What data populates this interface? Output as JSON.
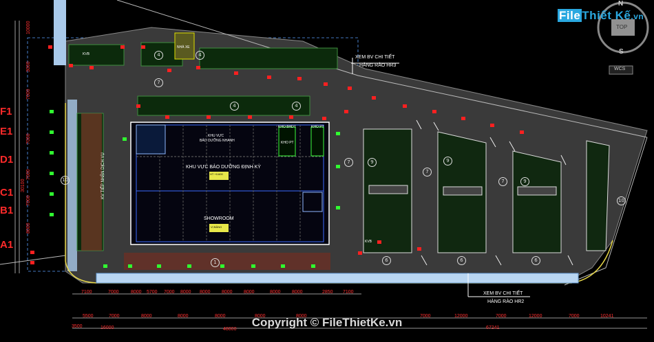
{
  "watermark": {
    "brand": "File",
    "brand2": "Thiết Kế",
    "domain": ".vn",
    "copyright": "Copyright © FileThietKe.vn"
  },
  "compass": {
    "north": "N",
    "south": "S",
    "center": "TOP",
    "wcs": "WCS"
  },
  "axes": [
    "F1",
    "E1",
    "D1",
    "C1",
    "B1",
    "A1"
  ],
  "notes": {
    "hr3_line1": "XEM BV CHI TIẾT",
    "hr3_line2": "HÀNG RÀO HR3",
    "hr2_line1": "XEM BV CHI TIẾT",
    "hr2_line2": "HÀNG RÀO HR2"
  },
  "building": {
    "maintenance_area": "KHU VỰC BẢO DƯỠNG ĐỊNH KỲ",
    "showroom": "SHOWROOM",
    "tag_top": "KHU VỰC",
    "tag_sub": "BẢO DƯỠNG NHANH",
    "room_a": "KHO BHDT",
    "room_b": "KHO PT",
    "room_c": "KHO PT",
    "elev1": "HT +0.600",
    "elev2": "VỊ BẢNG"
  },
  "side_labels": {
    "left_strip": "KV TIẾP NHẬN DỊCH VỤ",
    "gate": "KVB",
    "gate2": "KVB",
    "guard": "NHÀ XE"
  },
  "dims_row1": [
    "7100",
    "7000",
    "8000",
    "5700",
    "7000",
    "8000",
    "8000",
    "8000",
    "8000",
    "8000",
    "8000",
    "2850",
    "7100"
  ],
  "dims_row2": [
    "5500",
    "7000",
    "8000",
    "8000",
    "8000",
    "8000",
    "8000",
    "7000",
    "12000",
    "7000",
    "12000",
    "7000",
    "10241"
  ],
  "dims_row3": [
    "3500",
    "16000",
    "48000",
    "67241"
  ],
  "left_dims": [
    "10000",
    "3000",
    "7000",
    "7000",
    "7000",
    "7000",
    "8000",
    "30100"
  ],
  "circles": [
    "4",
    "4",
    "7",
    "4",
    "4",
    "7",
    "9",
    "7",
    "9",
    "7",
    "9",
    "10",
    "10",
    "6",
    "6",
    "6",
    "1",
    "7",
    "2",
    "9",
    "9",
    "9"
  ]
}
